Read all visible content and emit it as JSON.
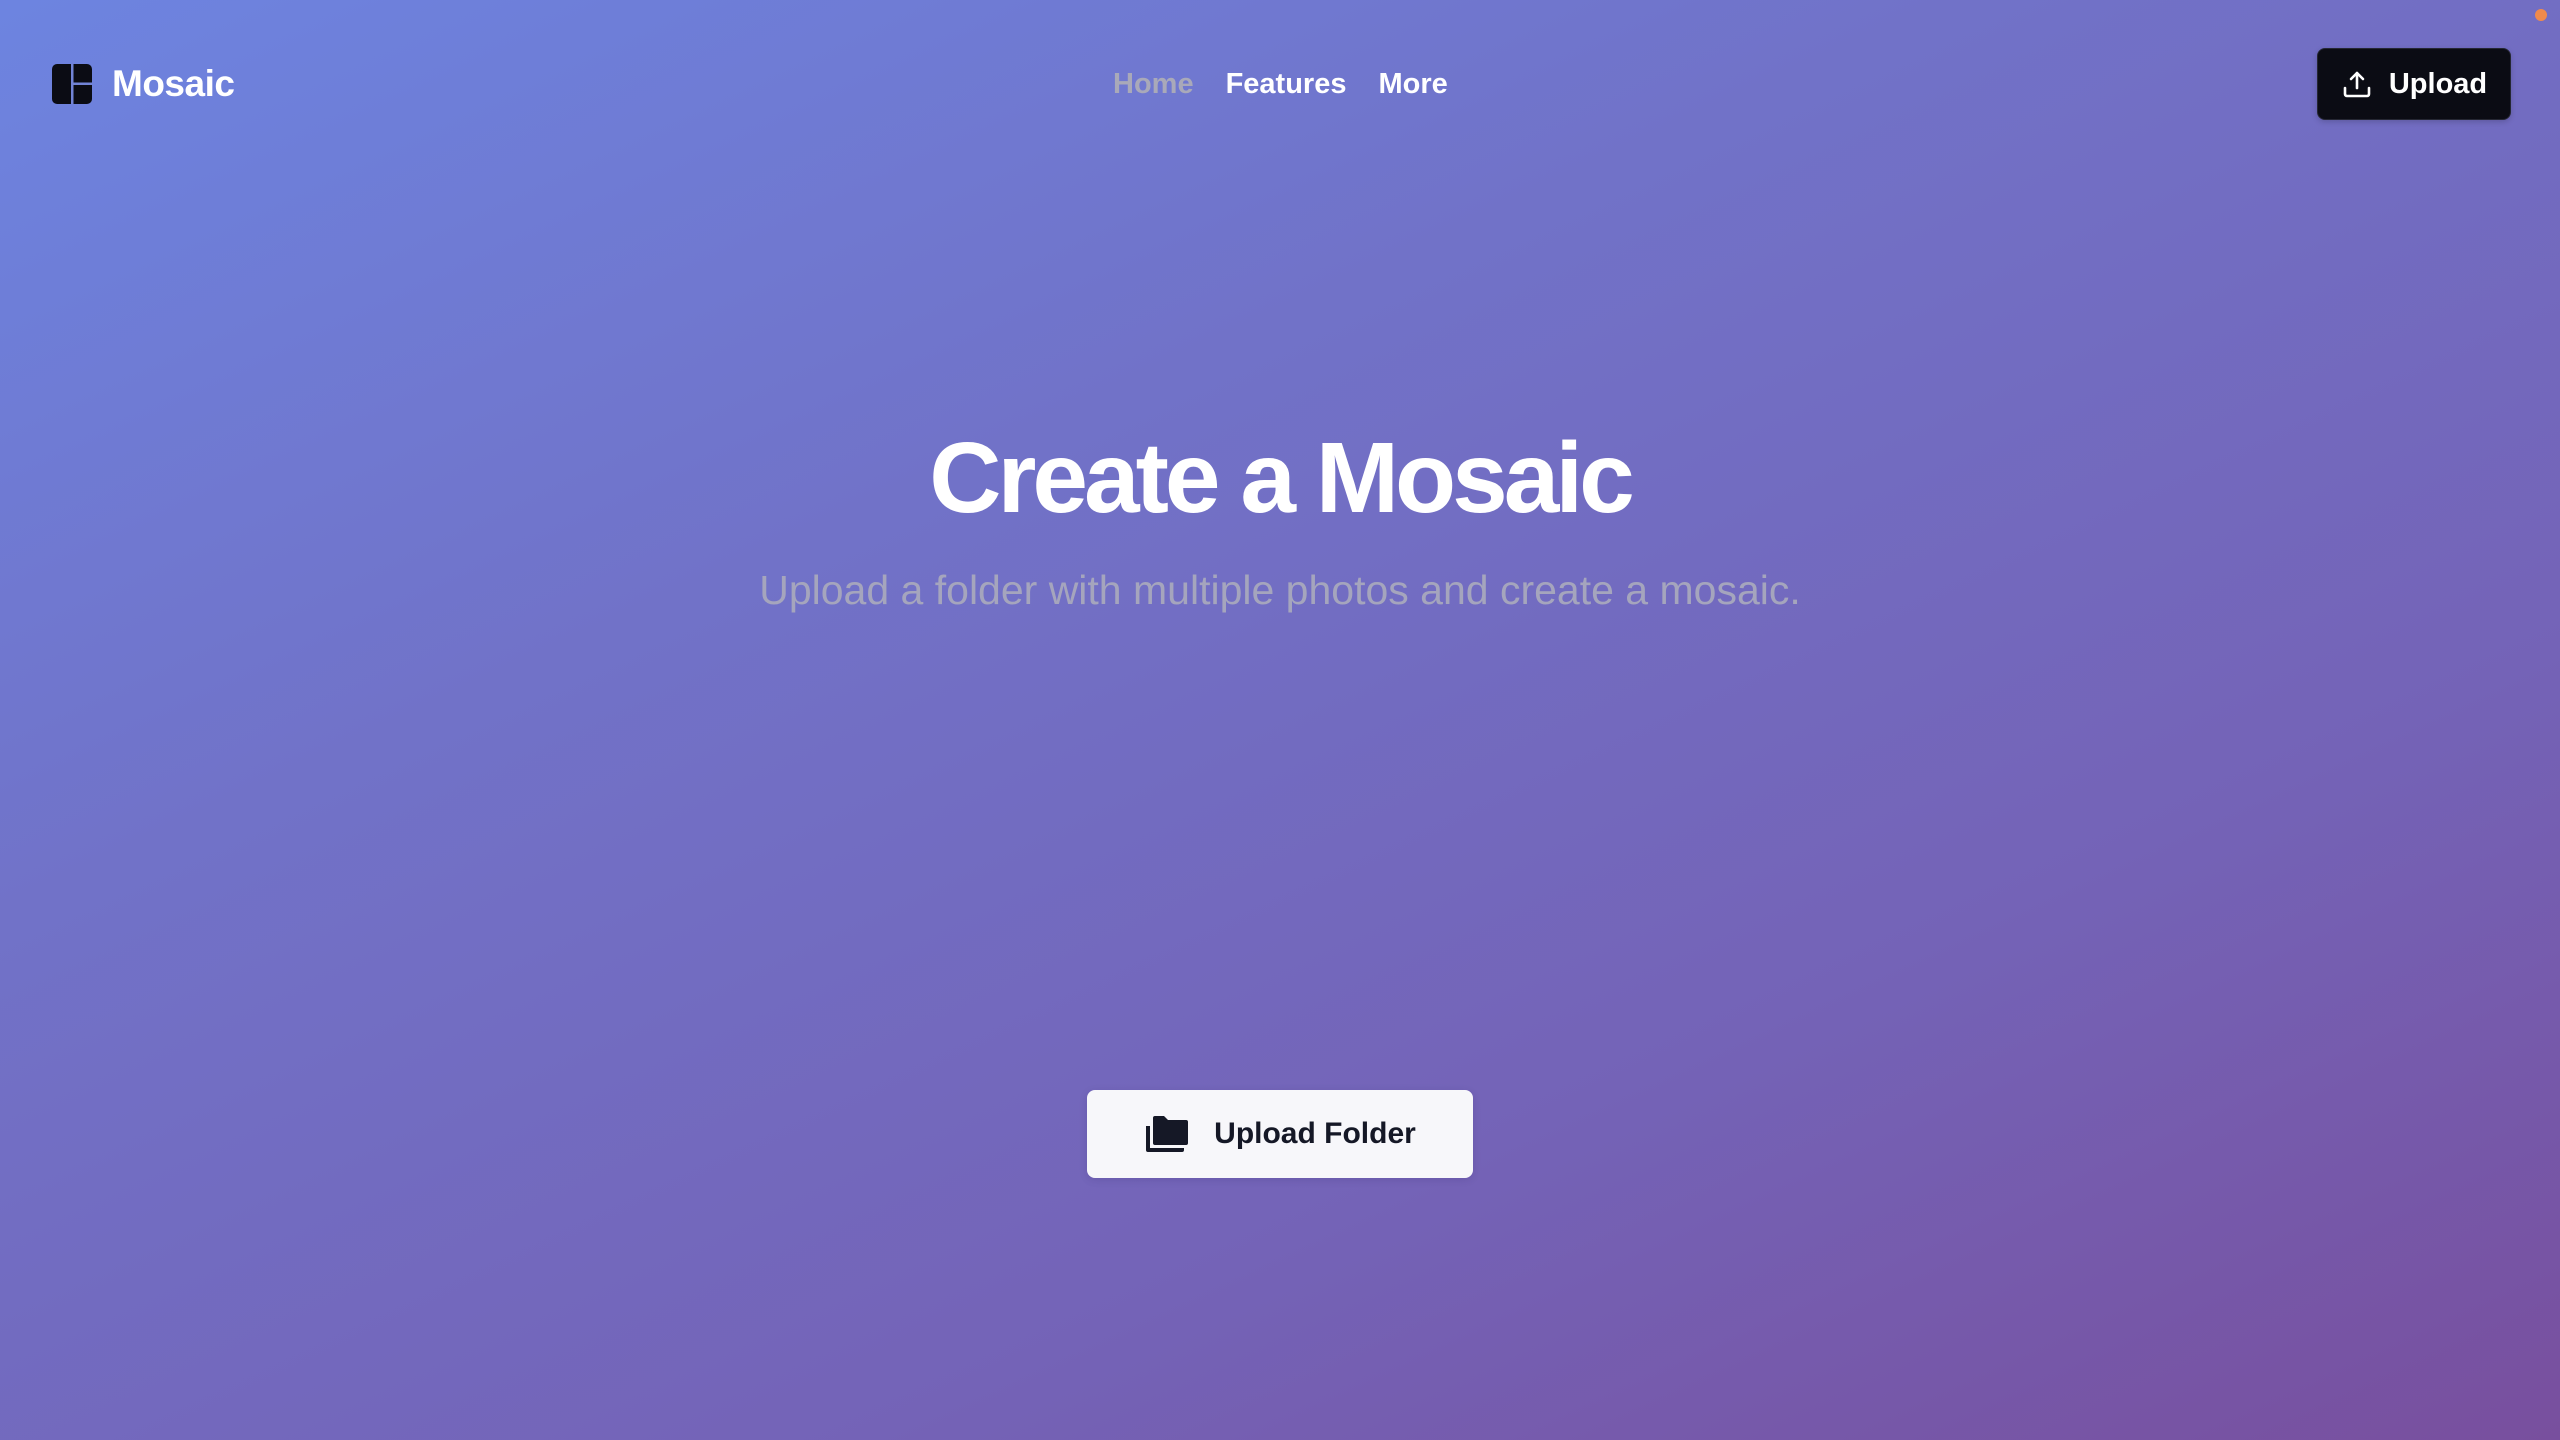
{
  "header": {
    "brand": {
      "name": "Mosaic",
      "icon": "layout-panels-icon"
    },
    "nav": [
      {
        "label": "Home",
        "active": true
      },
      {
        "label": "Features",
        "active": false
      },
      {
        "label": "More",
        "active": false
      }
    ],
    "upload_button": {
      "label": "Upload",
      "icon": "upload-icon"
    }
  },
  "hero": {
    "title": "Create a Mosaic",
    "subtitle": "Upload a folder with multiple photos and create a mosaic."
  },
  "actions": {
    "upload_folder": {
      "label": "Upload Folder",
      "icon": "folders-icon"
    }
  },
  "colors": {
    "gradient_start": "#6d84e0",
    "gradient_end": "#784f9e",
    "primary_button_bg": "#0b0c14",
    "secondary_button_bg": "#f7f7fa",
    "nav_active": "#a9a9b9",
    "subtitle": "#a5a5bd",
    "status_dot": "#f08a4b"
  }
}
